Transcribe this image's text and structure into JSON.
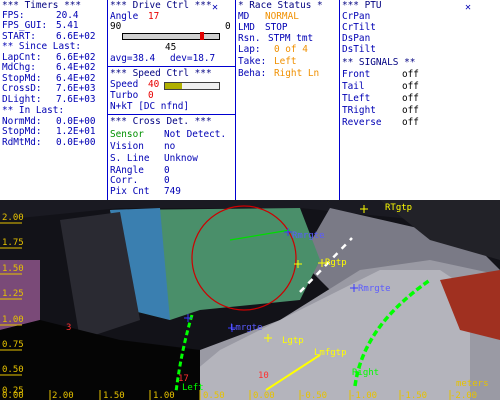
{
  "timers": {
    "header": "*** Timers ***",
    "fps_label": "FPS:",
    "fps_value": "20.4",
    "fps_gui_label": "FPS_GUI:",
    "fps_gui_value": "5.41",
    "start_label": "START:",
    "start_value": "6.6E+02",
    "since_last_header": "** Since Last:",
    "since_last": [
      {
        "label": "LapCnt:",
        "value": "6.6E+02"
      },
      {
        "label": "MdChg:",
        "value": "6.4E+02"
      },
      {
        "label": "StopMd:",
        "value": "6.4E+02"
      },
      {
        "label": "CrossD:",
        "value": "7.6E+03"
      },
      {
        "label": "DLight:",
        "value": "7.6E+03"
      }
    ],
    "in_last_header": "** In Last:",
    "in_last": [
      {
        "label": "NormMd:",
        "value": "0.0E+00"
      },
      {
        "label": "StopMd:",
        "value": "1.2E+01"
      },
      {
        "label": "RdMtMd:",
        "value": "0.0E+00"
      }
    ]
  },
  "drive_ctrl": {
    "header": "*** Drive Ctrl ***",
    "angle_label": "Angle",
    "angle_value": "17",
    "range_min": "90",
    "range_max": "0",
    "center_value": "45",
    "avg_text": "avg=38.4",
    "dev_text": "dev=18.7",
    "slider_level_fraction": 0.84
  },
  "speed_ctrl": {
    "header": "*** Speed Ctrl ***",
    "speed_label": "Speed",
    "speed_value": "40",
    "speed_level_fraction": 0.32,
    "turbo_label": "Turbo",
    "turbo_value": "0",
    "nkt_text": "N+kT [DC nfnd]"
  },
  "cross_det": {
    "header": "*** Cross Det. ***",
    "sensor_label": "Sensor",
    "sensor_value": "Not Detect.",
    "vision_label": "Vision",
    "vision_value": "no",
    "sline_label": "S. Line",
    "sline_value": "Unknow",
    "rangle_label": "RAngle",
    "rangle_value": "0",
    "corr_label": "Corr.",
    "corr_value": "0",
    "pix_label": "Pix Cnt",
    "pix_value": "749"
  },
  "race_status": {
    "header": "* Race Status *",
    "md_label": "MD",
    "md_value": "NORMAL",
    "lmd_label": "LMD",
    "lmd_value": "STOP",
    "rsn_label": "Rsn.",
    "rsn_value": "STPM tmt",
    "lap_label": "Lap:",
    "lap_value": "0 of 4",
    "take_label": "Take:",
    "take_value": "Left",
    "beha_label": "Beha:",
    "beha_value": "Right Ln"
  },
  "ptu": {
    "header": "*** PTU",
    "items": [
      "CrPan",
      "CrTilt",
      "DsPan",
      "DsTilt"
    ]
  },
  "signals": {
    "header": "** SIGNALS **",
    "items": [
      {
        "label": "Front",
        "value": "off"
      },
      {
        "label": "Tail",
        "value": "off"
      },
      {
        "label": "TLeft",
        "value": "off"
      },
      {
        "label": "TRight",
        "value": "off"
      },
      {
        "label": "Reverse",
        "value": "off"
      }
    ]
  },
  "camera": {
    "colors": {
      "boundary": "#00ff00",
      "target": "#ffff00",
      "circle": "#cc0000",
      "marker": "#3a3aff"
    },
    "left_axis": [
      "2.00",
      "1.75",
      "1.50",
      "1.25",
      "1.00",
      "0.75",
      "0.50",
      "0.25"
    ],
    "bottom_axis": [
      "0.00",
      "2.00",
      "1.50",
      "1.00",
      "0.50",
      "0.00",
      "-0.50",
      "-1.00",
      "-1.50",
      "-2.00"
    ],
    "units_label": "meters",
    "labels": {
      "rgtp_top": "RTgtp",
      "rmrgte_top": "Rmrgte",
      "rgtp_mid": "Rgtp",
      "rmrgte_mid": "Rmrgte",
      "lmrgte": "Lmrgte",
      "lgtp": "Lgtp",
      "lmfgtp": "Lmfgtp",
      "right": "Right",
      "left": "Left",
      "num_3": "3",
      "num_17": "17",
      "num_10": "10"
    }
  }
}
